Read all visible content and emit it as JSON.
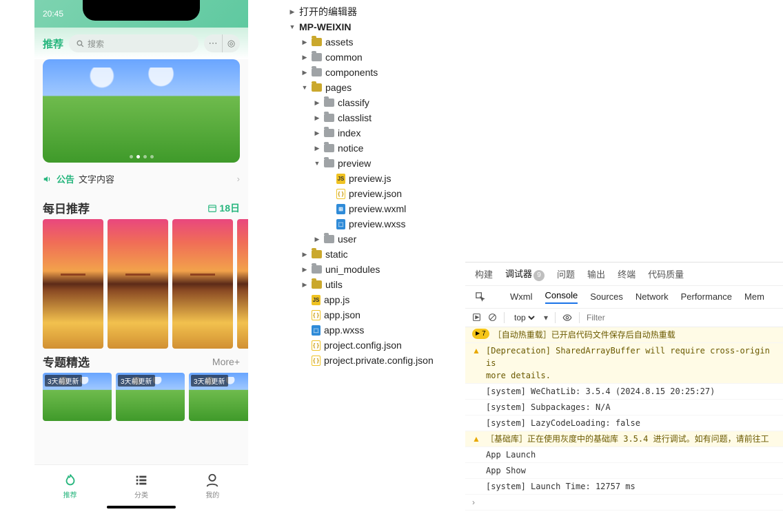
{
  "phone": {
    "time": "20:45",
    "tab_recommend": "推荐",
    "search_placeholder": "搜索",
    "notice_label": "公告",
    "notice_text": "文字内容",
    "daily_title": "每日推荐",
    "daily_date": "18日",
    "topic_title": "专题精选",
    "topic_more": "More+",
    "topic_tag": "3天前更新",
    "tabbar": [
      {
        "label": "推荐",
        "active": true
      },
      {
        "label": "分类",
        "active": false
      },
      {
        "label": "我的",
        "active": false
      }
    ]
  },
  "tree": {
    "root1": "打开的编辑器",
    "root2": "MP-WEIXIN",
    "nodes": [
      {
        "d": 1,
        "exp": "▶",
        "ic": "folder",
        "name": "assets"
      },
      {
        "d": 1,
        "exp": "▶",
        "ic": "folder-gray",
        "name": "common"
      },
      {
        "d": 1,
        "exp": "▶",
        "ic": "folder-gray",
        "name": "components"
      },
      {
        "d": 1,
        "exp": "▼",
        "ic": "folder",
        "name": "pages"
      },
      {
        "d": 2,
        "exp": "▶",
        "ic": "folder-gray",
        "name": "classify"
      },
      {
        "d": 2,
        "exp": "▶",
        "ic": "folder-gray",
        "name": "classlist"
      },
      {
        "d": 2,
        "exp": "▶",
        "ic": "folder-gray",
        "name": "index"
      },
      {
        "d": 2,
        "exp": "▶",
        "ic": "folder-gray",
        "name": "notice"
      },
      {
        "d": 2,
        "exp": "▼",
        "ic": "folder-gray",
        "name": "preview"
      },
      {
        "d": 3,
        "exp": "",
        "ic": "js",
        "name": "preview.js"
      },
      {
        "d": 3,
        "exp": "",
        "ic": "json",
        "name": "preview.json"
      },
      {
        "d": 3,
        "exp": "",
        "ic": "wxml",
        "name": "preview.wxml"
      },
      {
        "d": 3,
        "exp": "",
        "ic": "wxss",
        "name": "preview.wxss"
      },
      {
        "d": 2,
        "exp": "▶",
        "ic": "folder-gray",
        "name": "user"
      },
      {
        "d": 1,
        "exp": "▶",
        "ic": "folder",
        "name": "static"
      },
      {
        "d": 1,
        "exp": "▶",
        "ic": "folder-gray",
        "name": "uni_modules"
      },
      {
        "d": 1,
        "exp": "▶",
        "ic": "folder",
        "name": "utils"
      },
      {
        "d": 1,
        "exp": "",
        "ic": "js",
        "name": "app.js"
      },
      {
        "d": 1,
        "exp": "",
        "ic": "json",
        "name": "app.json"
      },
      {
        "d": 1,
        "exp": "",
        "ic": "wxss",
        "name": "app.wxss"
      },
      {
        "d": 1,
        "exp": "",
        "ic": "json",
        "name": "project.config.json"
      },
      {
        "d": 1,
        "exp": "",
        "ic": "json",
        "name": "project.private.config.json"
      }
    ]
  },
  "devtools": {
    "tabs1": [
      "构建",
      "调试器",
      "问题",
      "输出",
      "终端",
      "代码质量"
    ],
    "tabs1_active": "调试器",
    "tabs1_badge": "9",
    "tabs2": [
      "Wxml",
      "Console",
      "Sources",
      "Network",
      "Performance",
      "Mem"
    ],
    "tabs2_active": "Console",
    "scope": "top",
    "filter_placeholder": "Filter",
    "hot_reload_count": "7",
    "logs": [
      {
        "type": "hot",
        "text": "［自动热重载］已开启代码文件保存后自动热重载"
      },
      {
        "type": "warn",
        "text": "[Deprecation] SharedArrayBuffer will require cross-origin is\nmore details."
      },
      {
        "type": "plain",
        "text": "[system] WeChatLib: 3.5.4 (2024.8.15 20:25:27)"
      },
      {
        "type": "plain",
        "text": "[system] Subpackages: N/A"
      },
      {
        "type": "plain",
        "text": "[system] LazyCodeLoading: false"
      },
      {
        "type": "warn",
        "text": "［基础库］正在使用灰度中的基础库 3.5.4 进行调试。如有问题，请前往工"
      },
      {
        "type": "plain",
        "text": "App Launch"
      },
      {
        "type": "plain",
        "text": "App Show"
      },
      {
        "type": "plain",
        "text": "[system] Launch Time: 12757 ms"
      },
      {
        "type": "arrow",
        "text": ""
      }
    ]
  }
}
